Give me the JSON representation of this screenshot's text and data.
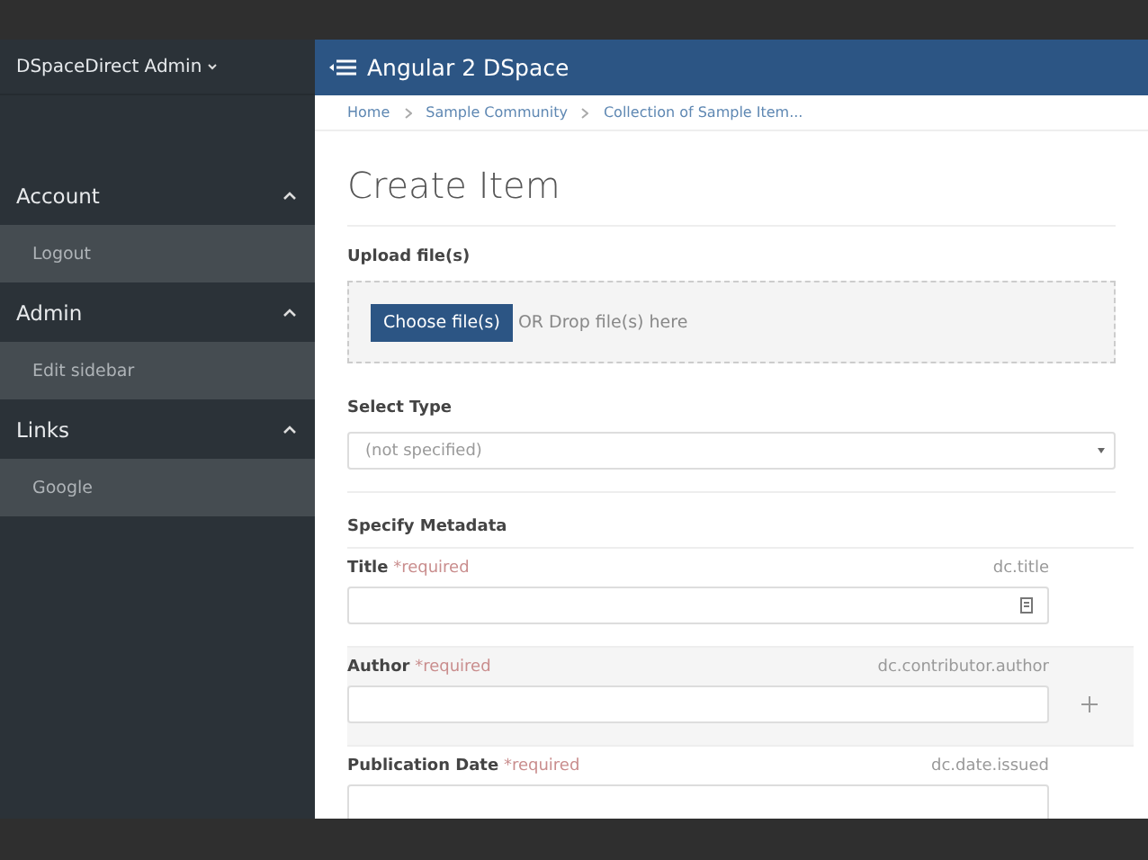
{
  "sidebar": {
    "title": "DSpaceDirect Admin",
    "sections": [
      {
        "label": "Account",
        "expanded": true,
        "items": [
          "Logout"
        ]
      },
      {
        "label": "Admin",
        "expanded": true,
        "items": [
          "Edit sidebar"
        ]
      },
      {
        "label": "Links",
        "expanded": true,
        "items": [
          "Google"
        ]
      }
    ]
  },
  "header": {
    "title": "Angular 2 DSpace"
  },
  "breadcrumbs": [
    "Home",
    "Sample Community",
    "Collection of Sample Item..."
  ],
  "heading": "Create Item",
  "upload": {
    "label": "Upload file(s)",
    "button": "Choose file(s)",
    "hint": "OR Drop file(s) here"
  },
  "type_select": {
    "label": "Select Type",
    "value": "(not specified)"
  },
  "metadata": {
    "heading": "Specify Metadata",
    "fields": [
      {
        "label": "Title",
        "required": "*required",
        "key": "dc.title",
        "kind": "text"
      },
      {
        "label": "Author",
        "required": "*required",
        "key": "dc.contributor.author",
        "kind": "repeatable"
      },
      {
        "label": "Publication Date",
        "required": "*required",
        "key": "dc.date.issued",
        "kind": "date"
      }
    ]
  }
}
